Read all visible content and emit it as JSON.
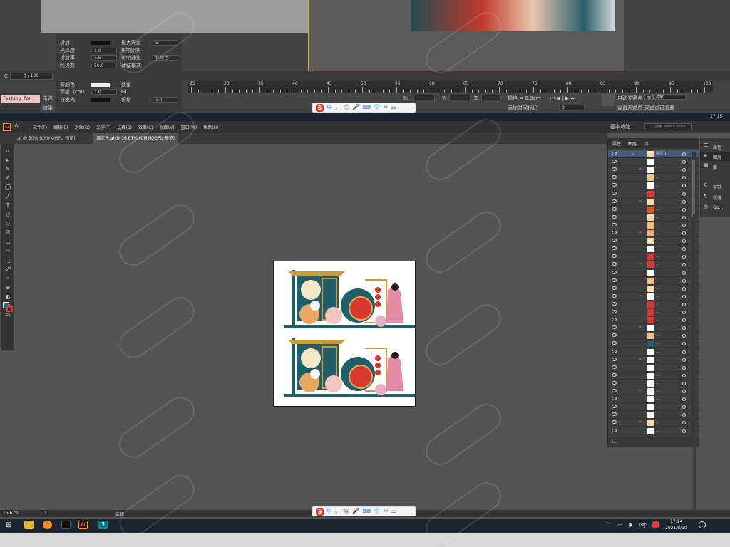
{
  "max": {
    "props_left": [
      {
        "label": "折射"
      },
      {
        "label": "光泽度",
        "val": "1.0"
      },
      {
        "label": "折射率",
        "val": "1.6"
      },
      {
        "label": "阿贝数",
        "val": "50.0"
      },
      {
        "label": "半透明",
        "val": "无"
      },
      {
        "label": "雾颜色"
      },
      {
        "label": "深度（cm）",
        "val": "1.0"
      },
      {
        "label": "自发光"
      }
    ],
    "props_right": [
      {
        "label": "最大深度",
        "val": "5"
      },
      {
        "label": "影响阴影"
      },
      {
        "label": "影响通道",
        "val": "仅颜色"
      },
      {
        "label": "薄壁模式"
      },
      {
        "label": "散射颜色"
      },
      {
        "label": "数量"
      },
      {
        "label": "GI"
      },
      {
        "label": "倍增",
        "val": "1.0"
      }
    ],
    "frame_counter": "0 / 100",
    "testing_label": "Testing for AII",
    "side_labels": [
      "未选",
      "渲染"
    ],
    "ticks": [
      "25",
      "30",
      "35",
      "40",
      "45",
      "50",
      "55",
      "60",
      "65",
      "70",
      "75",
      "80",
      "85",
      "90",
      "95",
      "100"
    ],
    "coords": {
      "x": "X:",
      "y": "Y:",
      "z": "Z:"
    },
    "grid": "栅格 = 0.0cm",
    "add_tag": "添加时间标记",
    "frame_input": "0",
    "auto_key": "自动关键点",
    "set_key": "设置关键点",
    "filter": "关键点过滤器",
    "selection": "选定对象",
    "time": "17:15"
  },
  "ime": [
    "中",
    "。",
    "☺",
    "🎤",
    "⌨",
    "👕",
    "✂",
    "⚏"
  ],
  "ai": {
    "menu": [
      "文件(F)",
      "编辑(E)",
      "对象(O)",
      "文字(T)",
      "选择(S)",
      "效果(C)",
      "视图(V)",
      "窗口(W)",
      "帮助(H)"
    ],
    "workspace": "基本功能",
    "search_placeholder": "搜索 Adobe Stock",
    "tabs": [
      ".ai @ 50% (CMYK/GPU 预览)",
      "源文件.ai @ 16.67% (CMYK/GPU 预览)"
    ],
    "panel_tabs": [
      "属性",
      "图层",
      "库"
    ],
    "layer_top": "图层 1",
    "layer_footer": "1...",
    "dock": [
      "属性",
      "图层",
      "库",
      "字符",
      "段落",
      "Op..."
    ],
    "zoom": "16.67%",
    "artboard_num": "1",
    "status": "选择",
    "tray_time": "17:14",
    "tray_date": "2021/8/19",
    "tray_lang": "中"
  }
}
